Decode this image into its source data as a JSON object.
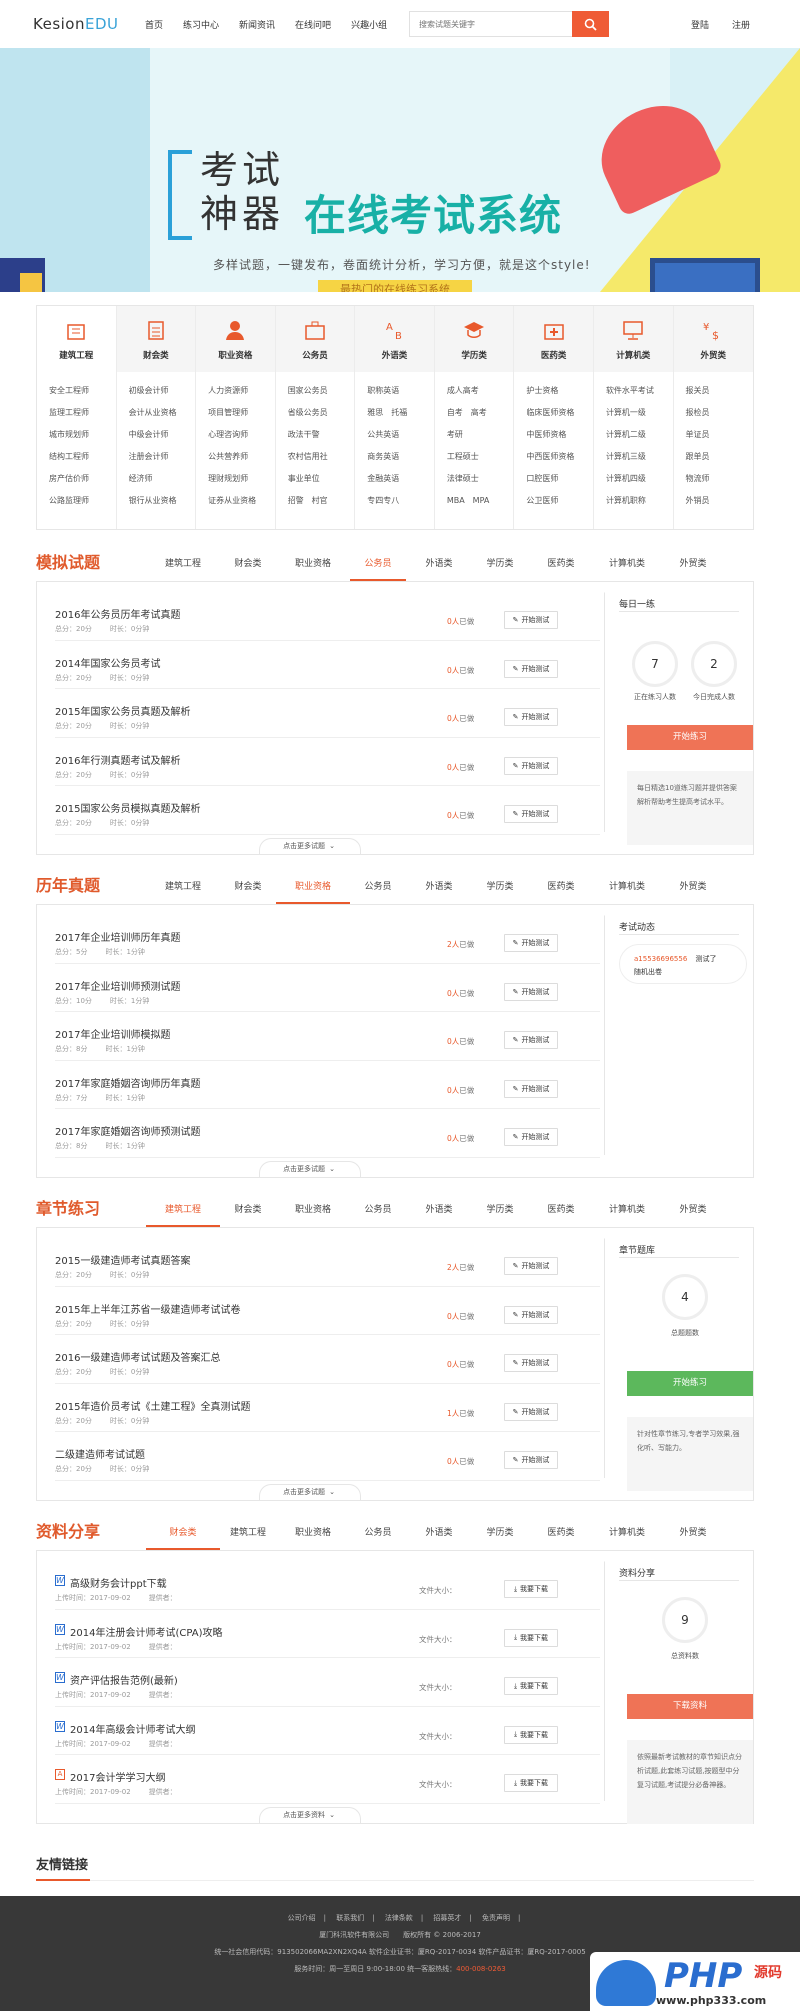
{
  "header": {
    "logo_a": "Kesion",
    "logo_b": "EDU",
    "nav": [
      "首页",
      "练习中心",
      "新闻资讯",
      "在线问吧",
      "兴趣小组"
    ],
    "search_placeholder": "搜索试题关键字",
    "login": "登陆",
    "register": "注册"
  },
  "banner": {
    "line1": "考试",
    "line2": "神器",
    "big": "在线考试系统",
    "sub": "多样试题，一键发布，卷面统计分析，学习方便，就是这个style!",
    "tag": "最热门的在线练习系统"
  },
  "categories": [
    {
      "title": "建筑工程",
      "icon": "building-icon",
      "items": [
        "安全工程师",
        "监理工程师",
        "城市规划师",
        "结构工程师",
        "房产估价师",
        "公路监理师"
      ]
    },
    {
      "title": "财会类",
      "icon": "calculator-icon",
      "items": [
        "初级会计师",
        "会计从业资格",
        "中级会计师",
        "注册会计师",
        "经济师",
        "银行从业资格"
      ]
    },
    {
      "title": "职业资格",
      "icon": "person-icon",
      "items": [
        "人力资源师",
        "项目管理师",
        "心理咨询师",
        "公共营养师",
        "理财规划师",
        "证券从业资格"
      ]
    },
    {
      "title": "公务员",
      "icon": "briefcase-icon",
      "items": [
        "国家公务员",
        "省级公务员",
        "政法干警",
        "农村信用社",
        "事业单位",
        "招警　村官"
      ]
    },
    {
      "title": "外语类",
      "icon": "language-icon",
      "items": [
        "职称英语",
        "雅思　托福",
        "公共英语",
        "商务英语",
        "金融英语",
        "专四专八"
      ]
    },
    {
      "title": "学历类",
      "icon": "graduation-cap-icon",
      "items": [
        "成人高考",
        "自考　高考",
        "考研",
        "工程硕士",
        "法律硕士",
        "MBA　MPA"
      ]
    },
    {
      "title": "医药类",
      "icon": "medical-kit-icon",
      "items": [
        "护士资格",
        "临床医师资格",
        "中医师资格",
        "中西医师资格",
        "口腔医师",
        "公卫医师"
      ]
    },
    {
      "title": "计算机类",
      "icon": "monitor-icon",
      "items": [
        "软件水平考试",
        "计算机一级",
        "计算机二级",
        "计算机三级",
        "计算机四级",
        "计算机职称"
      ]
    },
    {
      "title": "外贸类",
      "icon": "currency-icon",
      "items": [
        "报关员",
        "报检员",
        "单证员",
        "跟单员",
        "物流师",
        "外销员"
      ]
    }
  ],
  "mock": {
    "title": "模拟试题",
    "tabs": [
      "建筑工程",
      "财会类",
      "职业资格",
      "公务员",
      "外语类",
      "学历类",
      "医药类",
      "计算机类",
      "外贸类"
    ],
    "active": 3,
    "items": [
      {
        "name": "2016年公务员历年考试真题",
        "score": "总分：20分",
        "time": "时长：0分钟",
        "count": "0人",
        "done": "已做",
        "btn": "开始测试"
      },
      {
        "name": "2014年国家公务员考试",
        "score": "总分：20分",
        "time": "时长：0分钟",
        "count": "0人",
        "done": "已做",
        "btn": "开始测试"
      },
      {
        "name": "2015年国家公务员真题及解析",
        "score": "总分：20分",
        "time": "时长：0分钟",
        "count": "0人",
        "done": "已做",
        "btn": "开始测试"
      },
      {
        "name": "2016年行测真题考试及解析",
        "score": "总分：20分",
        "time": "时长：0分钟",
        "count": "0人",
        "done": "已做",
        "btn": "开始测试"
      },
      {
        "name": "2015国家公务员模拟真题及解析",
        "score": "总分：20分",
        "time": "时长：0分钟",
        "count": "0人",
        "done": "已做",
        "btn": "开始测试"
      }
    ],
    "more": "点击更多试题",
    "side": {
      "title": "每日一练",
      "n1": "7",
      "l1": "正在练习人数",
      "n2": "2",
      "l2": "今日完成人数",
      "btn": "开始练习",
      "note": "每日精选10道练习题并提供答案解析帮助考生提高考试水平。"
    }
  },
  "past": {
    "title": "历年真题",
    "tabs": [
      "建筑工程",
      "财会类",
      "职业资格",
      "公务员",
      "外语类",
      "学历类",
      "医药类",
      "计算机类",
      "外贸类"
    ],
    "active": 2,
    "items": [
      {
        "name": "2017年企业培训师历年真题",
        "score": "总分：5分",
        "time": "时长：1分钟",
        "count": "2人",
        "done": "已做",
        "btn": "开始测试"
      },
      {
        "name": "2017年企业培训师预测试题",
        "score": "总分：10分",
        "time": "时长：1分钟",
        "count": "0人",
        "done": "已做",
        "btn": "开始测试"
      },
      {
        "name": "2017年企业培训师模拟题",
        "score": "总分：8分",
        "time": "时长：1分钟",
        "count": "0人",
        "done": "已做",
        "btn": "开始测试"
      },
      {
        "name": "2017年家庭婚姻咨询师历年真题",
        "score": "总分：7分",
        "time": "时长：1分钟",
        "count": "0人",
        "done": "已做",
        "btn": "开始测试"
      },
      {
        "name": "2017年家庭婚姻咨询师预测试题",
        "score": "总分：8分",
        "time": "时长：1分钟",
        "count": "0人",
        "done": "已做",
        "btn": "开始测试"
      }
    ],
    "more": "点击更多试题",
    "side": {
      "title": "考试动态",
      "user": "a15536696556",
      "action": "测试了",
      "test": "随机出卷"
    }
  },
  "chapter": {
    "title": "章节练习",
    "tabs": [
      "建筑工程",
      "财会类",
      "职业资格",
      "公务员",
      "外语类",
      "学历类",
      "医药类",
      "计算机类",
      "外贸类"
    ],
    "active": 0,
    "items": [
      {
        "name": "2015一级建造师考试真题答案",
        "score": "总分：20分",
        "time": "时长：0分钟",
        "count": "2人",
        "done": "已做",
        "btn": "开始测试"
      },
      {
        "name": "2015年上半年江苏省一级建造师考试试卷",
        "score": "总分：20分",
        "time": "时长：0分钟",
        "count": "0人",
        "done": "已做",
        "btn": "开始测试"
      },
      {
        "name": "2016一级建造师考试试题及答案汇总",
        "score": "总分：20分",
        "time": "时长：0分钟",
        "count": "0人",
        "done": "已做",
        "btn": "开始测试"
      },
      {
        "name": "2015年造价员考试《土建工程》全真测试题",
        "score": "总分：20分",
        "time": "时长：0分钟",
        "count": "1人",
        "done": "已做",
        "btn": "开始测试"
      },
      {
        "name": "二级建造师考试试题",
        "score": "总分：20分",
        "time": "时长：0分钟",
        "count": "0人",
        "done": "已做",
        "btn": "开始测试"
      }
    ],
    "more": "点击更多试题",
    "side": {
      "title": "章节题库",
      "n1": "4",
      "l1": "总题题数",
      "btn": "开始练习",
      "note": "针对性章节练习,专者学习效果,强化听、写能力。"
    }
  },
  "resources": {
    "title": "资料分享",
    "tabs": [
      "财会类",
      "建筑工程",
      "职业资格",
      "公务员",
      "外语类",
      "学历类",
      "医药类",
      "计算机类",
      "外贸类"
    ],
    "active": 0,
    "items": [
      {
        "name": "高级财务会计ppt下载",
        "date": "上传时间：2017-09-02",
        "provider": "提供者：",
        "size": "文件大小：",
        "btn": "我要下载",
        "type": "word"
      },
      {
        "name": "2014年注册会计师考试(CPA)攻略",
        "date": "上传时间：2017-09-02",
        "provider": "提供者：",
        "size": "文件大小：",
        "btn": "我要下载",
        "type": "word"
      },
      {
        "name": "资产评估报告范例(最新)",
        "date": "上传时间：2017-09-02",
        "provider": "提供者：",
        "size": "文件大小：",
        "btn": "我要下载",
        "type": "word"
      },
      {
        "name": "2014年高级会计师考试大纲",
        "date": "上传时间：2017-09-02",
        "provider": "提供者：",
        "size": "文件大小：",
        "btn": "我要下载",
        "type": "word"
      },
      {
        "name": "2017会计学学习大纲",
        "date": "上传时间：2017-09-02",
        "provider": "提供者：",
        "size": "文件大小：",
        "btn": "我要下载",
        "type": "pdf"
      }
    ],
    "more": "点击更多资料",
    "side": {
      "title": "资料分享",
      "n1": "9",
      "l1": "总资料数",
      "btn": "下载资料",
      "note": "依照最新考试教材的章节知识点分析试题,此套练习试题,按题型中分复习试题,考试提分必备神器。"
    }
  },
  "links": {
    "title": "友情链接"
  },
  "footer": {
    "links": [
      "公司介绍",
      "联系我们",
      "法律条款",
      "招募英才",
      "免责声明"
    ],
    "copy": "厦门科汛软件有限公司　　版权所有 © 2006-2017",
    "license": "统一社会信用代码：913502066MA2XN2XQ4A 软件企业证书：厦RQ-2017-0034 软件产品证书：厦RQ-2017-0005",
    "service": "服务时间：周一至周日 9:00-18:00 统一客服热线：",
    "phone": "400-008-0263"
  },
  "watermark": {
    "php": "PHP",
    "yuan": "源码",
    "url": "www.php333.com"
  },
  "colors": {
    "accent": "#e8592c",
    "orange_btn": "#ef7356",
    "green_btn": "#5cb85c",
    "red_btn": "#ef5b35"
  }
}
